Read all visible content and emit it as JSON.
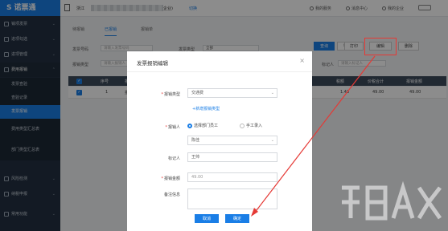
{
  "app": {
    "logo_text": "诺票通"
  },
  "sidebar": {
    "items": [
      {
        "label": "销项发票"
      },
      {
        "label": "进项勾选"
      },
      {
        "label": "进项管理"
      },
      {
        "label": "费用报销"
      }
    ],
    "sub_items": [
      {
        "label": "发票查验"
      },
      {
        "label": "查验记录"
      },
      {
        "label": "发票报销"
      },
      {
        "label": "费用类型汇总表"
      },
      {
        "label": "部门类型汇总表"
      }
    ],
    "bottom_items": [
      {
        "label": "风险检测"
      },
      {
        "label": "纳税申报"
      },
      {
        "label": "常用功能"
      }
    ]
  },
  "topbar": {
    "company_prefix": "浙江",
    "company_suffix": "企业)",
    "switch_label": "切换",
    "service": "我的服务",
    "messages": "消息中心",
    "my_company": "我的企业"
  },
  "tabs": [
    "待报销",
    "已报销",
    "报销单"
  ],
  "filters": {
    "invoice_no_label": "发票号码",
    "invoice_no_placeholder": "请输入发票号码",
    "invoice_type_label": "发票类型",
    "invoice_type_value": "全部",
    "reimburse_type_label": "报销类型",
    "reimburse_type_placeholder": "请输入报销人",
    "handler_label": "标记人",
    "handler_placeholder": "请输入标记人"
  },
  "toolbar": {
    "query": "查询",
    "export": "导出",
    "print": "打印",
    "edit": "编辑",
    "delete": "删除"
  },
  "table": {
    "headers": [
      "序号",
      "报",
      "税额",
      "价税合计",
      "报销金额"
    ],
    "rows": [
      {
        "index": "1",
        "name": "报",
        "tax": "1.43",
        "total": "49.00",
        "amount": "49.00"
      }
    ]
  },
  "modal": {
    "title": "发票报销编辑",
    "close": "×",
    "type_label": "报销类型",
    "type_value": "交通费",
    "add_type_link": "+新增报销类型",
    "person_label": "报销人",
    "radio_dept": "选择部门员工",
    "radio_manual": "手工录入",
    "person_value": "陈佳",
    "marker_label": "标记人",
    "marker_value": "王帅",
    "amount_label": "报销金额",
    "amount_value": "49.00",
    "remark_label": "备注信息",
    "cancel": "取消",
    "confirm": "确定"
  },
  "colors": {
    "brand": "#1a7ee6",
    "sidebar_bg": "#233142",
    "annotation": "#e53935"
  },
  "icons": [
    "document-icon",
    "gear-icon",
    "bell-icon",
    "user-icon",
    "chevron-down-icon"
  ]
}
